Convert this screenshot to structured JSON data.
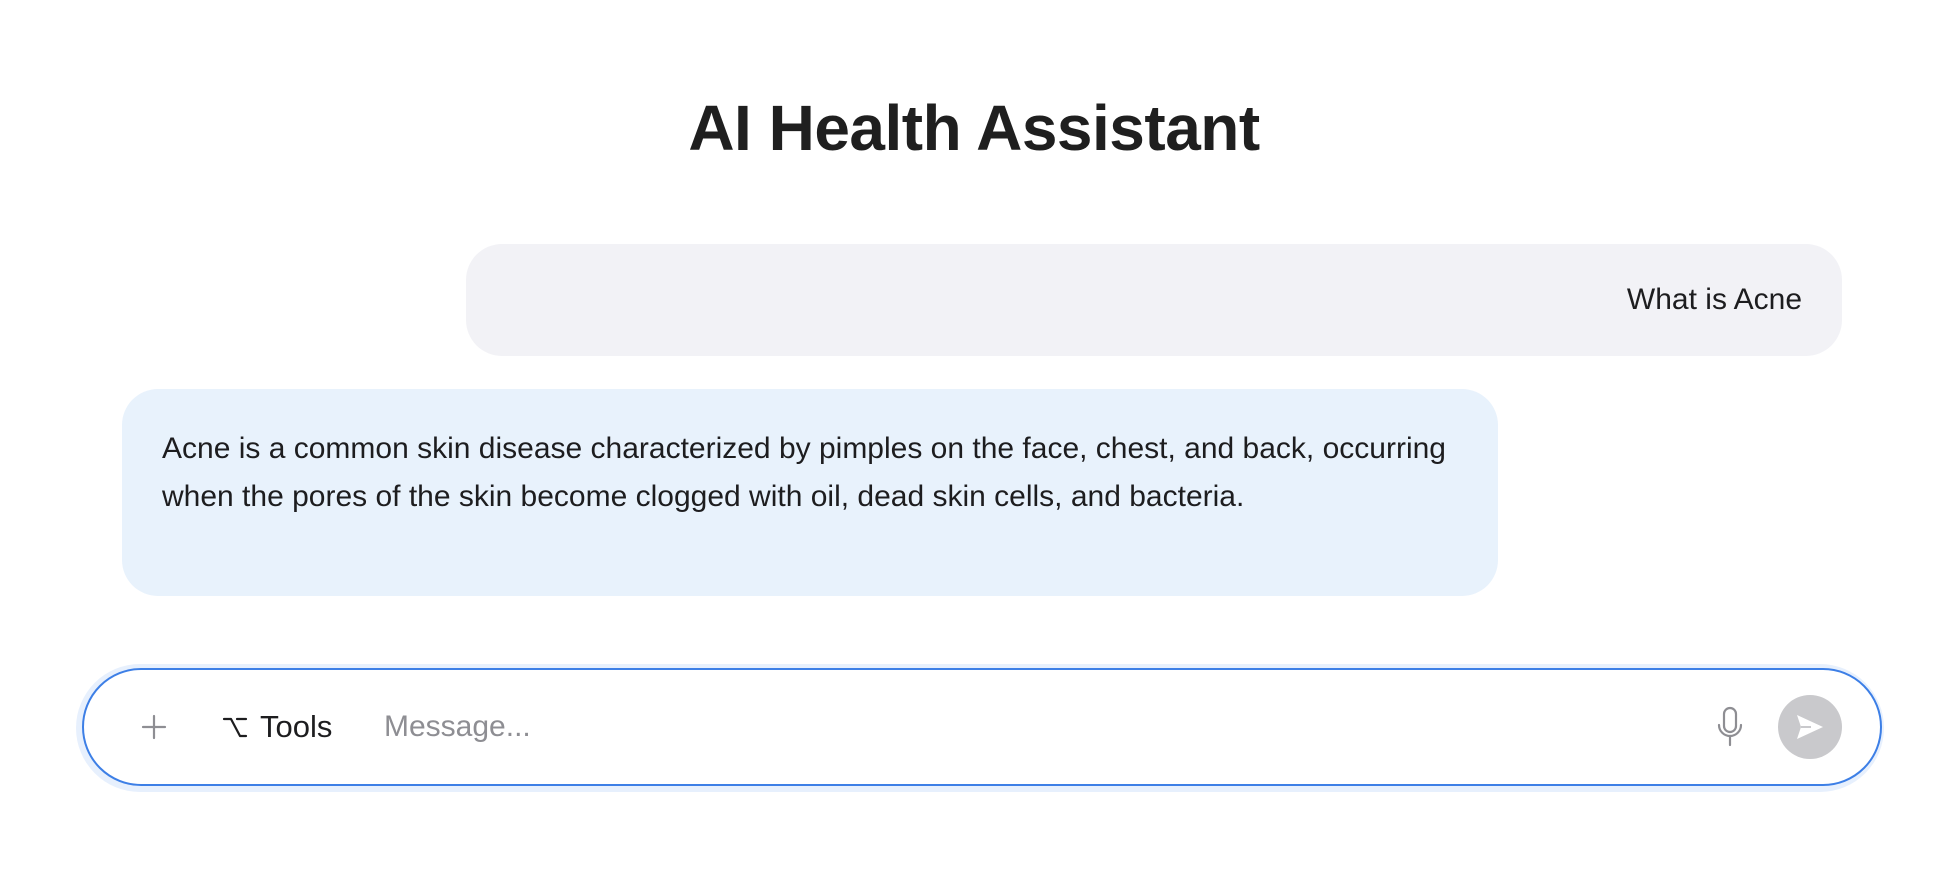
{
  "header": {
    "title": "AI Health Assistant"
  },
  "conversation": {
    "messages": [
      {
        "role": "user",
        "text": "What is Acne"
      },
      {
        "role": "assistant",
        "text": "Acne is a common skin disease characterized by pimples on the face, chest, and back, occurring when the pores of the skin become clogged with oil, dead skin cells, and bacteria."
      }
    ]
  },
  "composer": {
    "tools_label": "Tools",
    "message_value": "",
    "message_placeholder": "Message...",
    "icons": {
      "attach": "plus-icon",
      "tools": "option-key-icon",
      "voice": "microphone-icon",
      "send": "send-arrow-icon"
    }
  },
  "colors": {
    "user_bubble_bg": "#f2f2f6",
    "assistant_bubble_bg": "#e8f2fc",
    "composer_border": "#3d7fe6",
    "send_button_disabled": "#c9c9cc"
  }
}
